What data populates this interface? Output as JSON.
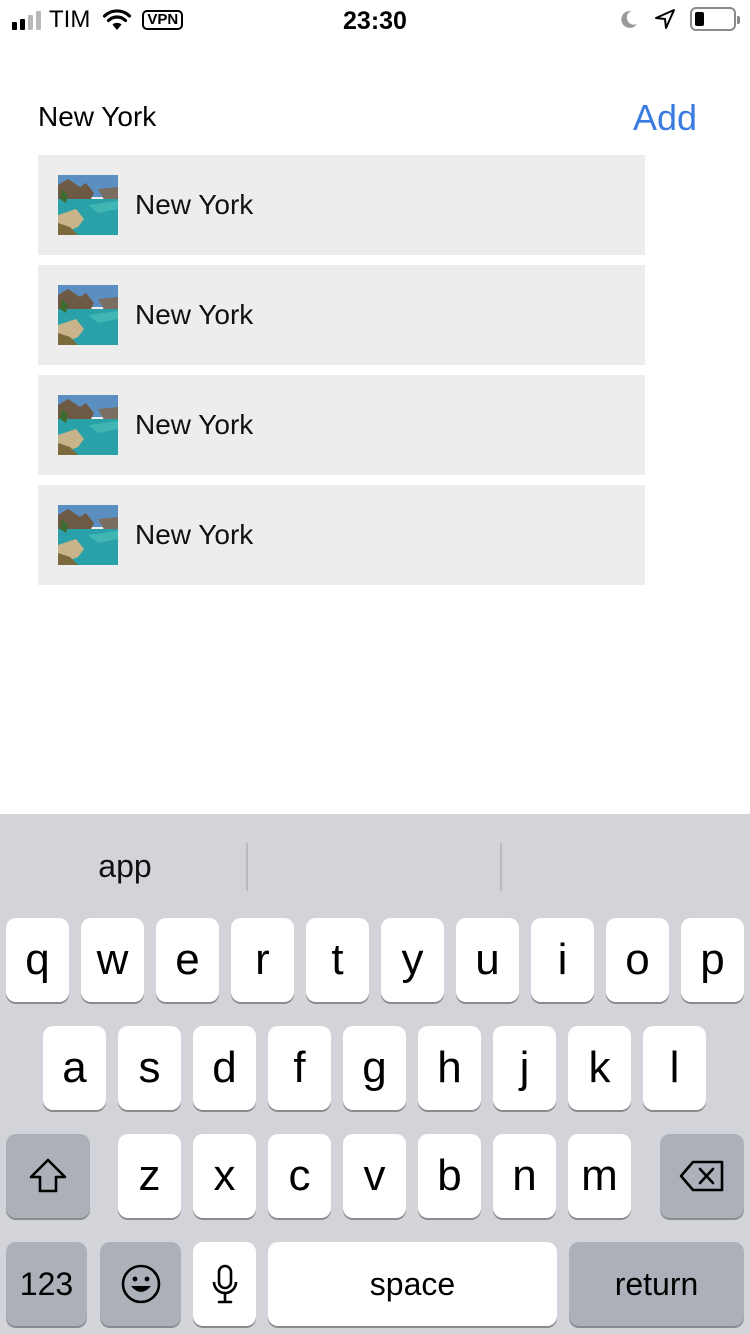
{
  "status_bar": {
    "carrier": "TIM",
    "vpn_label": "VPN",
    "time": "23:30",
    "battery_level": 0.25,
    "signal_bars": 4,
    "signal_bars_filled": 2,
    "icons": [
      "signal-icon",
      "wifi-icon",
      "moon-icon",
      "location-icon",
      "battery-icon"
    ]
  },
  "header": {
    "title": "New York",
    "add_label": "Add",
    "accent_color": "#3a7be0"
  },
  "list": {
    "items": [
      {
        "label": "New York",
        "thumbnail": "coastal-landscape-image"
      },
      {
        "label": "New York",
        "thumbnail": "coastal-landscape-image"
      },
      {
        "label": "New York",
        "thumbnail": "coastal-landscape-image"
      },
      {
        "label": "New York",
        "thumbnail": "coastal-landscape-image"
      }
    ]
  },
  "keyboard": {
    "suggestions": [
      "app",
      "",
      ""
    ],
    "row1": [
      "q",
      "w",
      "e",
      "r",
      "t",
      "y",
      "u",
      "i",
      "o",
      "p"
    ],
    "row2": [
      "a",
      "s",
      "d",
      "f",
      "g",
      "h",
      "j",
      "k",
      "l"
    ],
    "row3": [
      "z",
      "x",
      "c",
      "v",
      "b",
      "n",
      "m"
    ],
    "numbers_label": "123",
    "space_label": "space",
    "return_label": "return",
    "icons": [
      "shift-icon",
      "backspace-icon",
      "emoji-icon",
      "microphone-icon"
    ]
  }
}
